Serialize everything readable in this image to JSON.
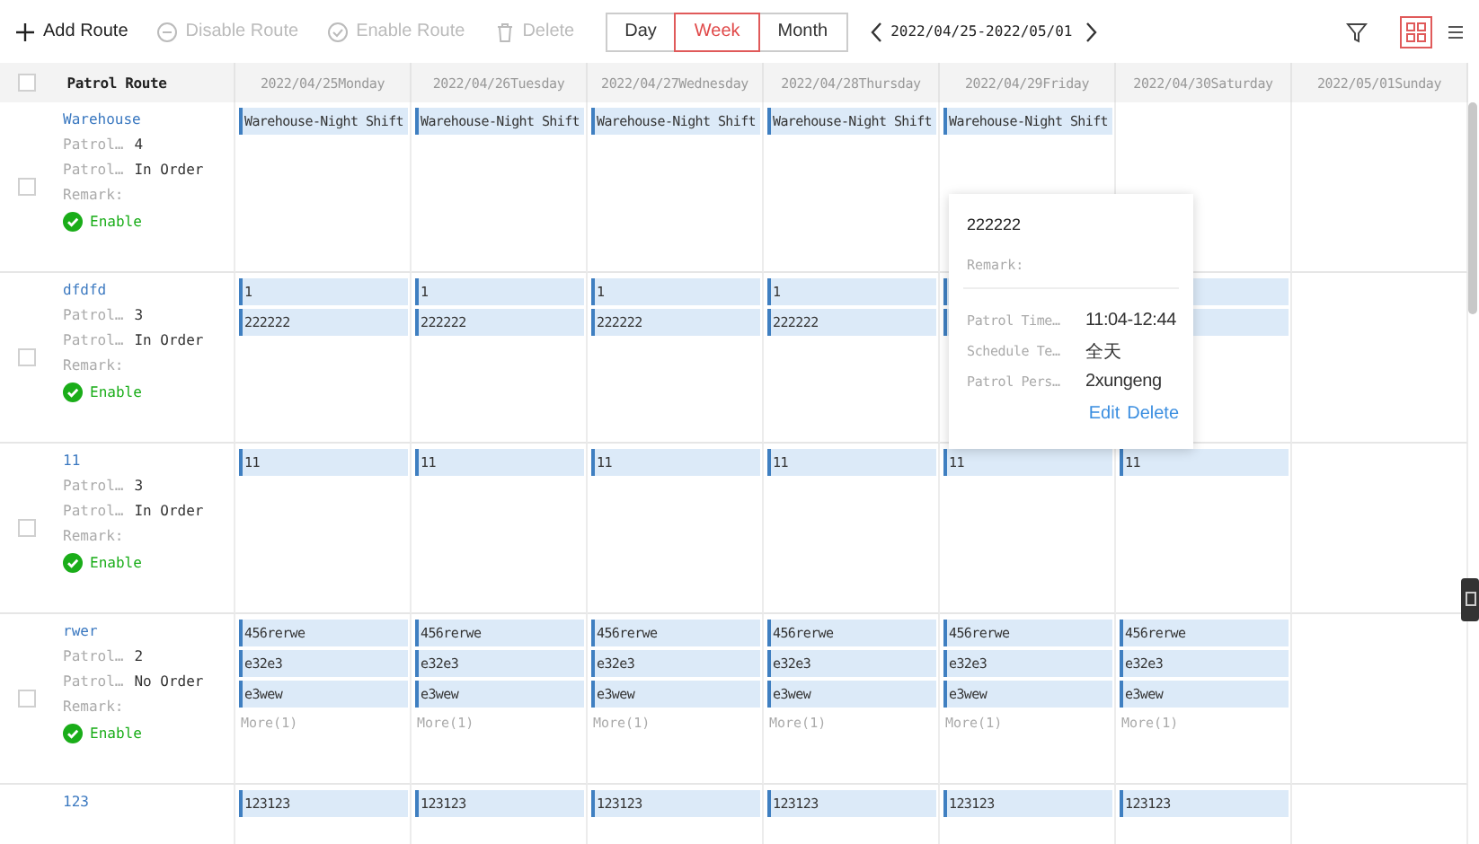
{
  "toolbar": {
    "actions": [
      {
        "label": "Add Route",
        "disabled": false
      },
      {
        "label": "Disable Route",
        "disabled": true
      },
      {
        "label": "Enable Route",
        "disabled": true
      },
      {
        "label": "Delete",
        "disabled": true
      }
    ],
    "views": [
      {
        "label": "Day",
        "selected": false
      },
      {
        "label": "Week",
        "selected": true
      },
      {
        "label": "Month",
        "selected": false
      }
    ],
    "date_range": "2022/04/25-2022/05/01",
    "layouts": [
      {
        "kind": "grid",
        "selected": true
      },
      {
        "kind": "list",
        "selected": false
      }
    ]
  },
  "table": {
    "header_checkbox": {
      "checked": false
    },
    "route_column": "Patrol Route",
    "days": [
      "2022/04/25Monday",
      "2022/04/26Tuesday",
      "2022/04/27Wednesday",
      "2022/04/28Thursday",
      "2022/04/29Friday",
      "2022/04/30Saturday",
      "2022/05/01Sunday"
    ],
    "rows": [
      {
        "checked": false,
        "name": "Warehouse",
        "fields": [
          {
            "label": "Patrol…",
            "value": "4"
          },
          {
            "label": "Patrol…",
            "value": "In Order"
          },
          {
            "label": "Remark:"
          }
        ],
        "status": {
          "label": "Enable",
          "enabled": true
        },
        "cells": [
          [
            {
              "label": "Warehouse-Night Shift"
            }
          ],
          [
            {
              "label": "Warehouse-Night Shift"
            }
          ],
          [
            {
              "label": "Warehouse-Night Shift"
            }
          ],
          [
            {
              "label": "Warehouse-Night Shift"
            }
          ],
          [
            {
              "label": "Warehouse-Night Shift"
            }
          ]
        ]
      },
      {
        "checked": false,
        "name": "dfdfd",
        "fields": [
          {
            "label": "Patrol…",
            "value": "3"
          },
          {
            "label": "Patrol…",
            "value": "In Order"
          },
          {
            "label": "Remark:"
          }
        ],
        "status": {
          "label": "Enable",
          "enabled": true
        },
        "cells": [
          [
            {
              "label": "1"
            },
            {
              "label": "222222"
            }
          ],
          [
            {
              "label": "1"
            },
            {
              "label": "222222"
            }
          ],
          [
            {
              "label": "1"
            },
            {
              "label": "222222"
            }
          ],
          [
            {
              "label": "1"
            },
            {
              "label": "222222"
            }
          ],
          [
            {
              "kind": "covered"
            },
            {
              "kind": "covered"
            }
          ],
          [
            {
              "kind": "covered"
            },
            {
              "kind": "covered"
            }
          ]
        ]
      },
      {
        "checked": false,
        "name": "11",
        "fields": [
          {
            "label": "Patrol…",
            "value": "3"
          },
          {
            "label": "Patrol…",
            "value": "In Order"
          },
          {
            "label": "Remark:"
          }
        ],
        "status": {
          "label": "Enable",
          "enabled": true
        },
        "cells": [
          [
            {
              "label": "11"
            }
          ],
          [
            {
              "label": "11"
            }
          ],
          [
            {
              "label": "11"
            }
          ],
          [
            {
              "label": "11"
            }
          ],
          [
            {
              "label": "11"
            }
          ],
          [
            {
              "label": "11"
            }
          ]
        ]
      },
      {
        "checked": false,
        "name": "rwer",
        "fields": [
          {
            "label": "Patrol…",
            "value": "2"
          },
          {
            "label": "Patrol…",
            "value": "No Order"
          },
          {
            "label": "Remark:"
          }
        ],
        "status": {
          "label": "Enable",
          "enabled": true
        },
        "cells": [
          [
            {
              "label": "456rerwe"
            },
            {
              "label": "e32e3"
            },
            {
              "label": "e3wew"
            },
            {
              "kind": "more",
              "label": "More(1)"
            }
          ],
          [
            {
              "label": "456rerwe"
            },
            {
              "label": "e32e3"
            },
            {
              "label": "e3wew"
            },
            {
              "kind": "more",
              "label": "More(1)"
            }
          ],
          [
            {
              "label": "456rerwe"
            },
            {
              "label": "e32e3"
            },
            {
              "label": "e3wew"
            },
            {
              "kind": "more",
              "label": "More(1)"
            }
          ],
          [
            {
              "label": "456rerwe"
            },
            {
              "label": "e32e3"
            },
            {
              "label": "e3wew"
            },
            {
              "kind": "more",
              "label": "More(1)"
            }
          ],
          [
            {
              "label": "456rerwe"
            },
            {
              "label": "e32e3"
            },
            {
              "label": "e3wew"
            },
            {
              "kind": "more",
              "label": "More(1)"
            }
          ],
          [
            {
              "label": "456rerwe"
            },
            {
              "label": "e32e3"
            },
            {
              "label": "e3wew"
            },
            {
              "kind": "more",
              "label": "More(1)"
            }
          ]
        ]
      },
      {
        "name": "123",
        "cells": [
          [
            {
              "label": "123123"
            }
          ],
          [
            {
              "label": "123123"
            }
          ],
          [
            {
              "label": "123123"
            }
          ],
          [
            {
              "label": "123123"
            }
          ],
          [
            {
              "label": "123123"
            }
          ],
          [
            {
              "label": "123123"
            }
          ]
        ]
      }
    ]
  },
  "popup": {
    "title": "222222",
    "remark": "Remark:",
    "details": [
      {
        "label": "Patrol Time…",
        "value": "11:04-12:44"
      },
      {
        "label": "Schedule Te…",
        "value": "全天"
      },
      {
        "label": "Patrol Pers…",
        "value": "2xungeng"
      }
    ],
    "links": [
      "Edit",
      "Delete"
    ]
  }
}
